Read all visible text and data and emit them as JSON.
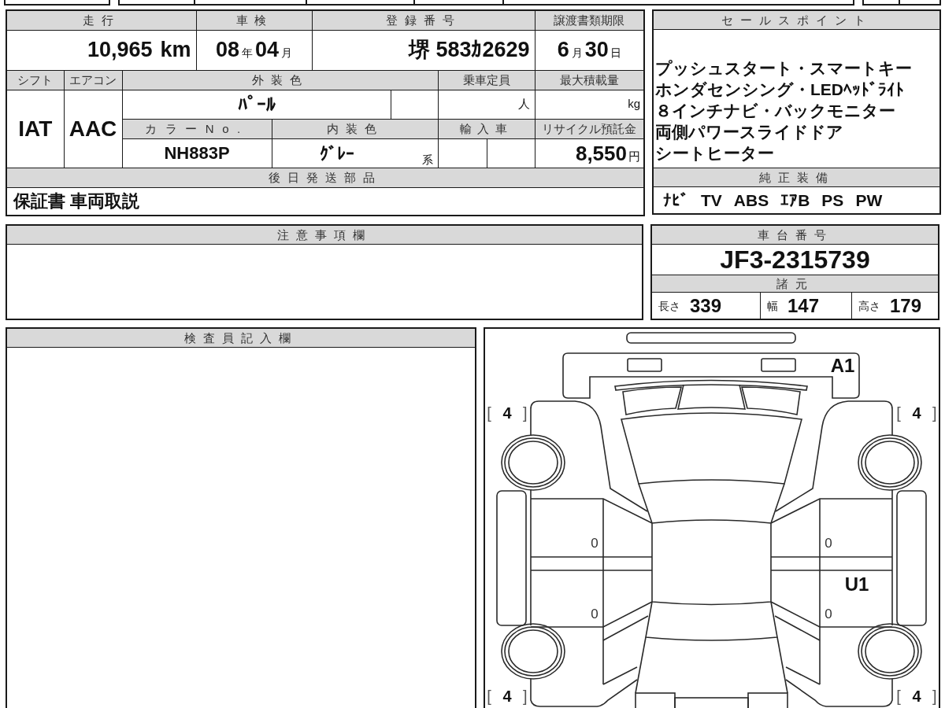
{
  "vehicle_table": {
    "mileage": {
      "label": "走行",
      "value": "10,965",
      "unit": "km"
    },
    "inspection": {
      "label": "車検",
      "year": "08",
      "year_unit": "年",
      "month": "04",
      "month_unit": "月"
    },
    "registration": {
      "label": "登録番号",
      "value": "堺 583ｶ2629"
    },
    "transfer_deadline": {
      "label": "譲渡書類期限",
      "month": "6",
      "month_unit": "月",
      "day": "30",
      "day_unit": "日"
    },
    "shift": {
      "label": "シフト",
      "value": "IAT"
    },
    "air_conditioning": {
      "label": "エアコン",
      "value": "AAC"
    },
    "exterior_color": {
      "label": "外装色",
      "value": "ﾊﾟｰﾙ"
    },
    "capacity": {
      "label": "乗車定員",
      "unit": "人"
    },
    "max_load": {
      "label": "最大積載量",
      "unit": "kg"
    },
    "color_no": {
      "label": "カラーNo.",
      "value": "NH883P"
    },
    "interior_color": {
      "label": "内装色",
      "value": "ｸﾞﾚｰ",
      "suffix": "系"
    },
    "imported": {
      "label": "輸入車"
    },
    "recycling_fee": {
      "label": "リサイクル預託金",
      "value": "8,550",
      "unit": "円"
    },
    "later_parts": {
      "label": "後日発送部品",
      "value": "保証書 車両取説"
    }
  },
  "sales_points": {
    "label": "セールスポイント",
    "lines": [
      "プッシュスタート・スマートキー",
      "ホンダセンシング・LEDﾍｯﾄﾞﾗｲﾄ",
      "８インチナビ・バックモニター",
      "両側パワースライドドア",
      "シートヒーター"
    ]
  },
  "equipment": {
    "label": "純正装備",
    "items": [
      "ﾅﾋﾞ",
      "TV",
      "ABS",
      "ｴｱB",
      "PS",
      "PW"
    ]
  },
  "notes": {
    "label": "注意事項欄"
  },
  "chassis": {
    "label": "車台番号",
    "value": "JF3-2315739"
  },
  "specs": {
    "label": "諸元",
    "items": [
      {
        "label": "長さ",
        "value": "339"
      },
      {
        "label": "幅",
        "value": "147"
      },
      {
        "label": "高さ",
        "value": "179"
      }
    ]
  },
  "inspector": {
    "label": "検査員記入欄"
  },
  "diagram": {
    "marks": [
      {
        "kind": "damage",
        "text": "A1"
      },
      {
        "kind": "tire",
        "text": "[ **4** ]"
      },
      {
        "kind": "tire",
        "text": "[ **4** ]"
      },
      {
        "kind": "count",
        "text": "0"
      },
      {
        "kind": "count",
        "text": "0"
      },
      {
        "kind": "damage",
        "text": "U1"
      },
      {
        "kind": "count",
        "text": "0"
      },
      {
        "kind": "count",
        "text": "0"
      },
      {
        "kind": "tire",
        "text": "[ **4** ]"
      },
      {
        "kind": "tire",
        "text": "[ **4** ]"
      }
    ]
  }
}
